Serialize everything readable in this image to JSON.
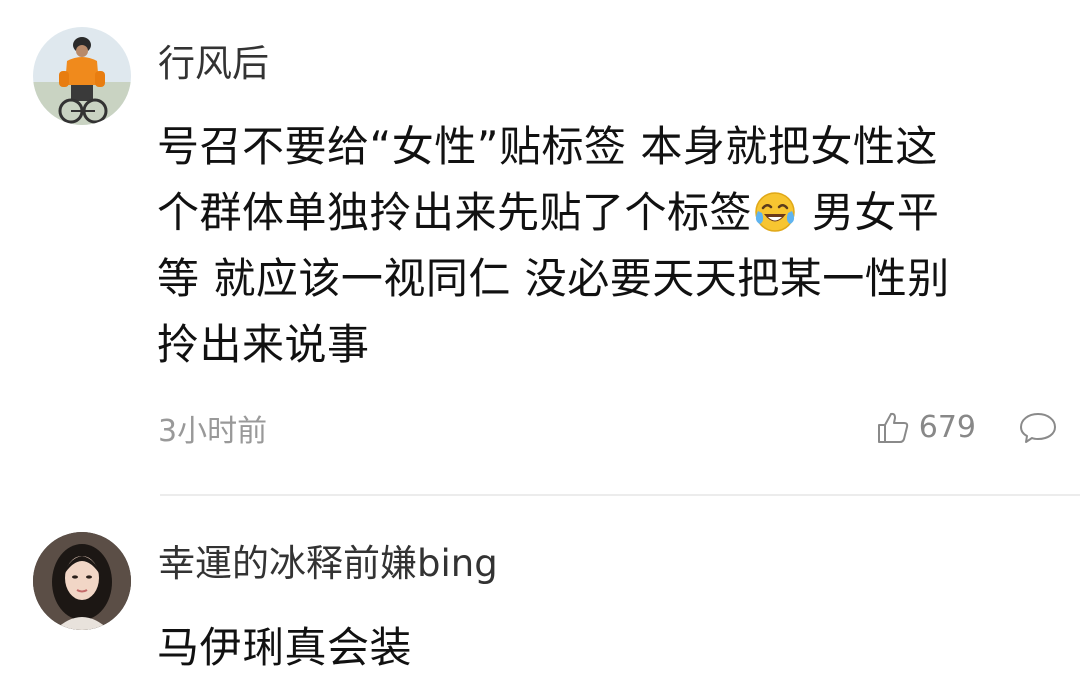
{
  "comments": [
    {
      "username": "行风后",
      "lines": [
        "号召不要给“女性”贴标签 本身就把女性这",
        "个群体单独拎出来先贴了个标签",
        " 男女平",
        "等 就应该一视同仁 没必要天天把某一性别",
        "拎出来说事"
      ],
      "emoji": "laughing-crying-emoji",
      "time": "3小时前",
      "likes": "679"
    },
    {
      "username": "幸運的冰释前嫌bing",
      "lines": [
        "马伊琍真会装"
      ]
    }
  ],
  "colors": {
    "username": "#333333",
    "text": "#111111",
    "meta": "#999999",
    "divider": "#ececec"
  }
}
